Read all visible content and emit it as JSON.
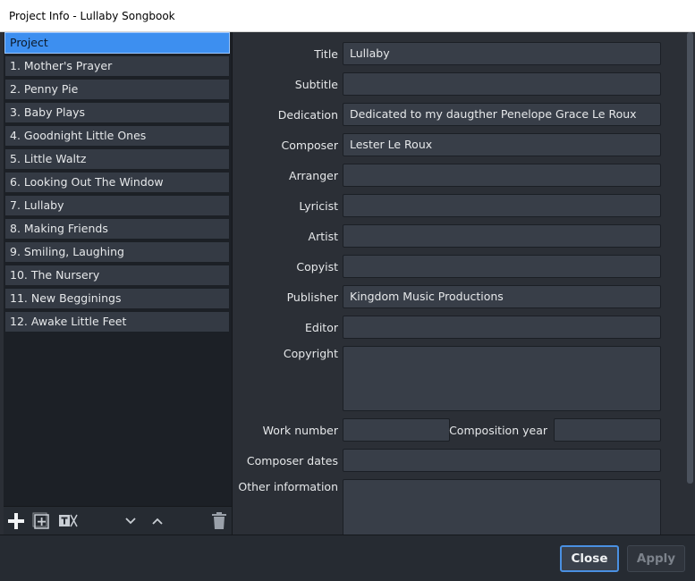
{
  "window": {
    "title": "Project Info - Lullaby Songbook"
  },
  "sidebar": {
    "items": [
      {
        "label": "Project"
      },
      {
        "label": "1. Mother's Prayer"
      },
      {
        "label": "2. Penny Pie"
      },
      {
        "label": "3. Baby Plays"
      },
      {
        "label": "4. Goodnight Little Ones"
      },
      {
        "label": "5. Little Waltz"
      },
      {
        "label": "6. Looking Out The Window"
      },
      {
        "label": "7. Lullaby"
      },
      {
        "label": "8. Making Friends"
      },
      {
        "label": "9. Smiling, Laughing"
      },
      {
        "label": "10. The Nursery"
      },
      {
        "label": "11. New Begginings"
      },
      {
        "label": "12. Awake Little Feet"
      }
    ],
    "selected_index": 0,
    "toolbar": {
      "add_icon": "plus-icon",
      "add_score_icon": "add-box-icon",
      "title_icon": "text-remove-icon",
      "move_down_icon": "chevron-down-icon",
      "move_up_icon": "chevron-up-icon",
      "delete_icon": "trash-icon"
    }
  },
  "form": {
    "title": {
      "label": "Title",
      "value": "Lullaby"
    },
    "subtitle": {
      "label": "Subtitle",
      "value": ""
    },
    "dedication": {
      "label": "Dedication",
      "value": "Dedicated to my daugther Penelope Grace Le Roux"
    },
    "composer": {
      "label": "Composer",
      "value": "Lester Le Roux"
    },
    "arranger": {
      "label": "Arranger",
      "value": ""
    },
    "lyricist": {
      "label": "Lyricist",
      "value": ""
    },
    "artist": {
      "label": "Artist",
      "value": ""
    },
    "copyist": {
      "label": "Copyist",
      "value": ""
    },
    "publisher": {
      "label": "Publisher",
      "value": "Kingdom Music Productions"
    },
    "editor": {
      "label": "Editor",
      "value": ""
    },
    "copyright": {
      "label": "Copyright",
      "value": ""
    },
    "work_number": {
      "label": "Work number",
      "value": ""
    },
    "composition_year": {
      "label": "Composition year",
      "value": ""
    },
    "composer_dates": {
      "label": "Composer dates",
      "value": ""
    },
    "other_information": {
      "label": "Other information",
      "value": ""
    }
  },
  "buttons": {
    "close": "Close",
    "apply": "Apply"
  },
  "colors": {
    "accent": "#3d8ff0",
    "panel_bg": "#2b2f36",
    "list_bg": "#1c2026",
    "input_bg": "#383e48"
  }
}
